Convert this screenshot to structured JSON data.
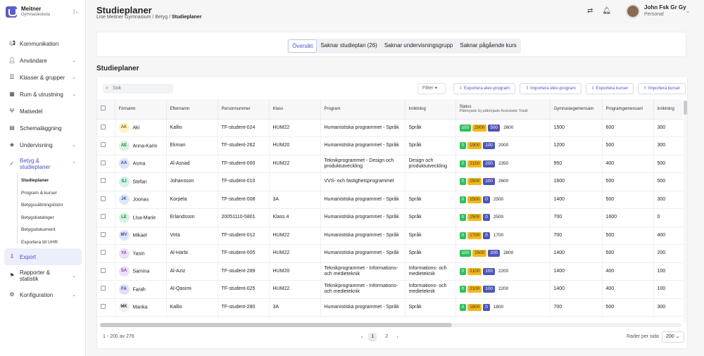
{
  "brand": {
    "name": "Meitner",
    "subtitle": "Gymnasieskola"
  },
  "nav": {
    "items": [
      {
        "label": "Kommunikation",
        "icon": "megaphone-icon",
        "chev": ""
      },
      {
        "label": "Användare",
        "icon": "users-icon",
        "chev": "⌄"
      },
      {
        "label": "Klasser & grupper",
        "icon": "list-icon",
        "chev": "⌄"
      },
      {
        "label": "Rum & utrustning",
        "icon": "building-icon",
        "chev": "⌄"
      },
      {
        "label": "Matsedel",
        "icon": "utensils-icon",
        "chev": ""
      },
      {
        "label": "Schemaläggning",
        "icon": "calendar-icon",
        "chev": ""
      },
      {
        "label": "Undervisning",
        "icon": "layers-icon",
        "chev": "⌄"
      }
    ],
    "grades_label_1": "Betyg &",
    "grades_label_2": "studieplaner",
    "sub": [
      "Studieplaner",
      "Program & kurser",
      "Betygssättningslistor",
      "Betygskataloger",
      "Betygsdokument",
      "Exportera till UHR"
    ],
    "export": "Export",
    "reports_1": "Rapporter &",
    "reports_2": "statistik",
    "config": "Konfiguration"
  },
  "header": {
    "title": "Studieplaner",
    "crumb1": "Lise Meitner Gymnasium",
    "crumb2": "Betyg",
    "crumb3": "Studieplaner",
    "user_name": "John Fsk Gr Gy",
    "user_role": "Personal"
  },
  "tabs": [
    "Översikt",
    "Saknar studieplan (26)",
    "Saknar undervisningsgrupp",
    "Saknar pågående kurs"
  ],
  "section_title": "Studieplaner",
  "toolbar": {
    "search_placeholder": "Sok",
    "filter": "Filter",
    "export_student": "Exportera elev-program",
    "import_student": "Importera elev-program",
    "export_courses": "Exportera kurser",
    "import_courses": "Importera kurser"
  },
  "columns": {
    "first": "Förnamn",
    "last": "Efternamn",
    "pnr": "Personnummer",
    "class": "Klass",
    "program": "Program",
    "direction": "Inriktning",
    "status": "Status",
    "status_sub": "Påbörjade  Ej påbörjade  Avslutade  Totalt",
    "gym": "Gymnasiegemensam",
    "prog": "Programgemensam",
    "inr": "Inriktning"
  },
  "rows": [
    {
      "ini": "AK",
      "c": "#fdf3c2",
      "fc": "#8a6d00",
      "first": "Aki",
      "last": "Kallio",
      "pnr": "TF-student-024",
      "class": "HUM22",
      "program": "Humanistiska programmet - Språk",
      "dir": "Språk",
      "s": [
        "100",
        "2000",
        "500",
        "2600"
      ],
      "g": "1500",
      "p": "600",
      "i": "300"
    },
    {
      "ini": "AE",
      "c": "#d7f3e2",
      "fc": "#16804a",
      "first": "Anna-Karin",
      "last": "Ekman",
      "pnr": "TF-student-262",
      "class": "HUM20",
      "program": "Humanistiska programmet - Språk",
      "dir": "Språk",
      "s": [
        "0",
        "1900",
        "100",
        "2000"
      ],
      "g": "1200",
      "p": "500",
      "i": "300"
    },
    {
      "ini": "AA",
      "c": "#dfe1f7",
      "fc": "#3d43a7",
      "first": "Asma",
      "last": "Al-Assad",
      "pnr": "TF-student-000",
      "class": "HUM22",
      "program": "Teknikprogrammet - Design och produktutveckling",
      "dir": "Design och produktutveckling",
      "s": [
        "0",
        "2150",
        "200",
        "2350"
      ],
      "g": "950",
      "p": "400",
      "i": "500"
    },
    {
      "ini": "SJ",
      "c": "#d4f3ea",
      "fc": "#137b5c",
      "first": "Stefan",
      "last": "Johansson",
      "pnr": "TF-student-010",
      "class": "",
      "program": "VVS- och fastighetsprogrammet",
      "dir": "",
      "s": [
        "0",
        "2500",
        "100",
        "2600"
      ],
      "g": "1600",
      "p": "500",
      "i": "500"
    },
    {
      "ini": "JK",
      "c": "#dde7f7",
      "fc": "#2f5aa0",
      "first": "Joonas",
      "last": "Korpela",
      "pnr": "TF-student-008",
      "class": "3A",
      "program": "Humanistiska programmet - Språk",
      "dir": "Språk",
      "s": [
        "0",
        "2500",
        "0",
        "2500"
      ],
      "g": "1400",
      "p": "500",
      "i": "300"
    },
    {
      "ini": "LE",
      "c": "#d7f3e2",
      "fc": "#16804a",
      "first": "Lisa-Marie",
      "last": "Erlandsson",
      "pnr": "20051110-5801",
      "class": "Klass 4",
      "program": "Humanistiska programmet - Språk",
      "dir": "Språk",
      "s": [
        "0",
        "2500",
        "0",
        "2500"
      ],
      "g": "700",
      "p": "1600",
      "i": "0"
    },
    {
      "ini": "MV",
      "c": "#dfe1f7",
      "fc": "#3d43a7",
      "first": "Mikael",
      "last": "Virta",
      "pnr": "TF-student-012",
      "class": "HUM22",
      "program": "Humanistiska programmet - Språk",
      "dir": "Språk",
      "s": [
        "0",
        "1700",
        "0",
        "1700"
      ],
      "g": "700",
      "p": "500",
      "i": "400"
    },
    {
      "ini": "YA",
      "c": "#ece0f7",
      "fc": "#7a3fb0",
      "first": "Yasin",
      "last": "Al-Harbi",
      "pnr": "TF-student-005",
      "class": "HUM22",
      "program": "Humanistiska programmet - Språk",
      "dir": "Språk",
      "s": [
        "100",
        "2500",
        "200",
        "2800"
      ],
      "g": "1400",
      "p": "500",
      "i": "200"
    },
    {
      "ini": "SA",
      "c": "#ece0f7",
      "fc": "#7a3fb0",
      "first": "Samina",
      "last": "Al-Aziz",
      "pnr": "TF-student-289",
      "class": "HUM20",
      "program": "Teknikprogrammet - Informations- och medieteknik",
      "dir": "Informations- och medieteknik",
      "s": [
        "0",
        "2100",
        "100",
        "2200"
      ],
      "g": "1400",
      "p": "400",
      "i": "100"
    },
    {
      "ini": "FA",
      "c": "#dfe1f7",
      "fc": "#3d43a7",
      "first": "Farah",
      "last": "Al-Qasimi",
      "pnr": "TF-student-025",
      "class": "HUM22",
      "program": "Teknikprogrammet - Informations- och medieteknik",
      "dir": "Informations- och medieteknik",
      "s": [
        "0",
        "2100",
        "100",
        "2200"
      ],
      "g": "1400",
      "p": "400",
      "i": "100"
    },
    {
      "ini": "MK",
      "c": "#f0f0f2",
      "fc": "#333",
      "first": "Manka",
      "last": "Kallio",
      "pnr": "TF-student-280",
      "class": "3A",
      "program": "Humanistiska programmet - Språk",
      "dir": "Språk",
      "s": [
        "0",
        "1800",
        "0",
        "1800"
      ],
      "g": "700",
      "p": "500",
      "i": "300"
    }
  ],
  "footer": {
    "count": "1 - 200 av 276",
    "pages": [
      "1",
      "2"
    ],
    "rows_per_page_label": "Rader per sida",
    "rows_per_page": "200"
  }
}
